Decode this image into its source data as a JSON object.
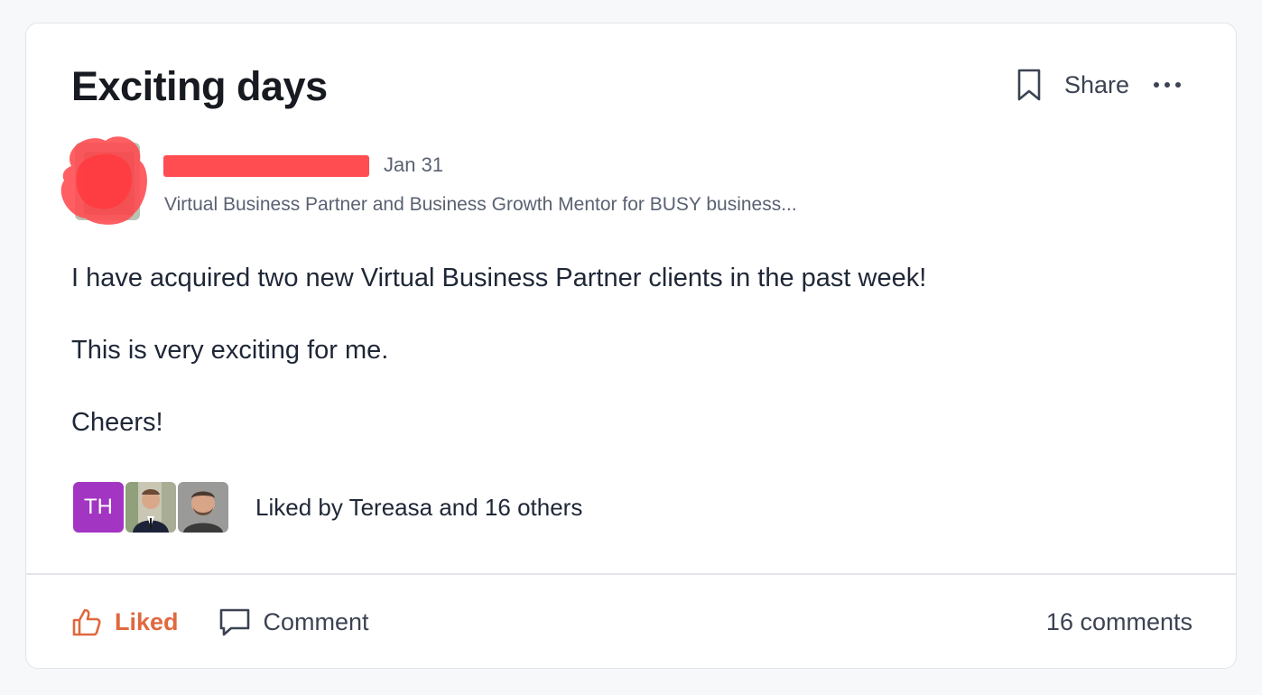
{
  "post": {
    "title": "Exciting days",
    "share_label": "Share",
    "date": "Jan 31",
    "author_tagline": "Virtual Business Partner and Business Growth Mentor for BUSY business...",
    "body": [
      "I have acquired two new Virtual Business Partner clients in the past week!",
      "This is very exciting for me.",
      "Cheers!"
    ]
  },
  "likes": {
    "avatars": [
      {
        "initials": "TH",
        "color": "#a236c2"
      },
      {
        "icon": "person-photo-1"
      },
      {
        "icon": "person-photo-2"
      }
    ],
    "summary": "Liked by Tereasa and 16 others"
  },
  "footer": {
    "liked_label": "Liked",
    "comment_label": "Comment",
    "comment_count": "16 comments"
  },
  "colors": {
    "liked_accent": "#e0683f",
    "redaction": "#ff4d52"
  }
}
